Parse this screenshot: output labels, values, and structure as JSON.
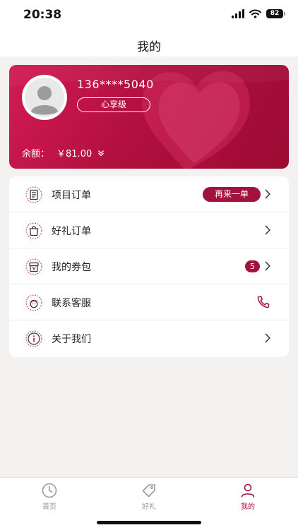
{
  "status_bar": {
    "time": "20:38",
    "battery": "82"
  },
  "nav": {
    "title": "我的"
  },
  "member": {
    "phone": "136****5040",
    "level": "心享级",
    "balance_label": "余额：",
    "balance_value": "￥81.00"
  },
  "menu": {
    "items": [
      {
        "label": "项目订单",
        "icon": "document-icon",
        "action": "再来一单"
      },
      {
        "label": "好礼订单",
        "icon": "gift-bag-icon"
      },
      {
        "label": "我的券包",
        "icon": "coupon-icon",
        "badge": "5"
      },
      {
        "label": "联系客服",
        "icon": "customer-service-icon"
      },
      {
        "label": "关于我们",
        "icon": "info-icon"
      }
    ]
  },
  "tabbar": {
    "items": [
      {
        "label": "首页",
        "icon": "clock-icon",
        "active": false
      },
      {
        "label": "好礼",
        "icon": "tag-icon",
        "active": false
      },
      {
        "label": "我的",
        "icon": "person-icon",
        "active": true
      }
    ]
  },
  "colors": {
    "brand": "#a3123d",
    "card_start": "#d21b55",
    "card_end": "#9c0b33",
    "background": "#f3f2f0"
  }
}
